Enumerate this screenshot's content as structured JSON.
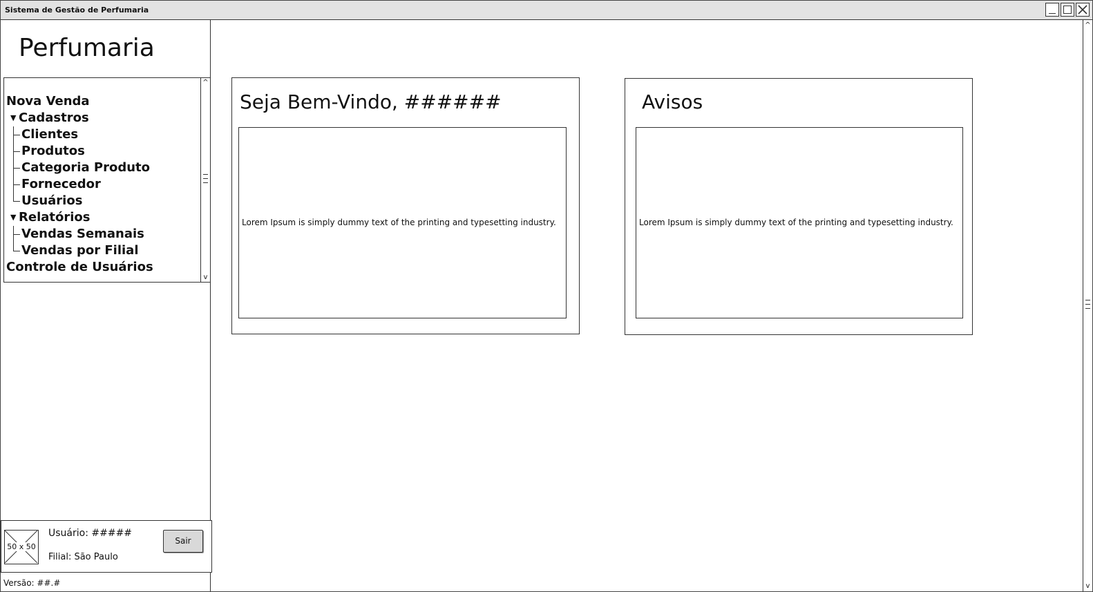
{
  "window": {
    "title": "Sistema de Gestão de Perfumaria"
  },
  "sidebar": {
    "app_name": "Perfumaria",
    "nav": {
      "nova_venda": "Nova Venda",
      "cadastros": {
        "label": "Cadastros",
        "items": [
          "Clientes",
          "Produtos",
          "Categoria Produto",
          "Fornecedor",
          "Usuários"
        ]
      },
      "relatorios": {
        "label": "Relatórios",
        "items": [
          "Vendas Semanais",
          "Vendas por Filial"
        ]
      },
      "controle_usuarios": "Controle de Usuários"
    },
    "user_panel": {
      "avatar_placeholder": "50 x 50",
      "user_label": "Usuário: #####",
      "filial_label": "Filial: São Paulo",
      "logout_label": "Sair"
    },
    "version": "Versão: ##.#"
  },
  "main": {
    "welcome": {
      "title": "Seja Bem-Vindo, ######",
      "text": "Lorem Ipsum is simply dummy text of the printing and typesetting industry."
    },
    "notices": {
      "title": "Avisos",
      "text": "Lorem Ipsum is simply dummy text of the printing and typesetting industry."
    }
  },
  "icons": {
    "minimize": "minimize-icon",
    "maximize": "maximize-icon",
    "close": "close-icon",
    "collapse_triangle": "triangle-down-icon"
  }
}
